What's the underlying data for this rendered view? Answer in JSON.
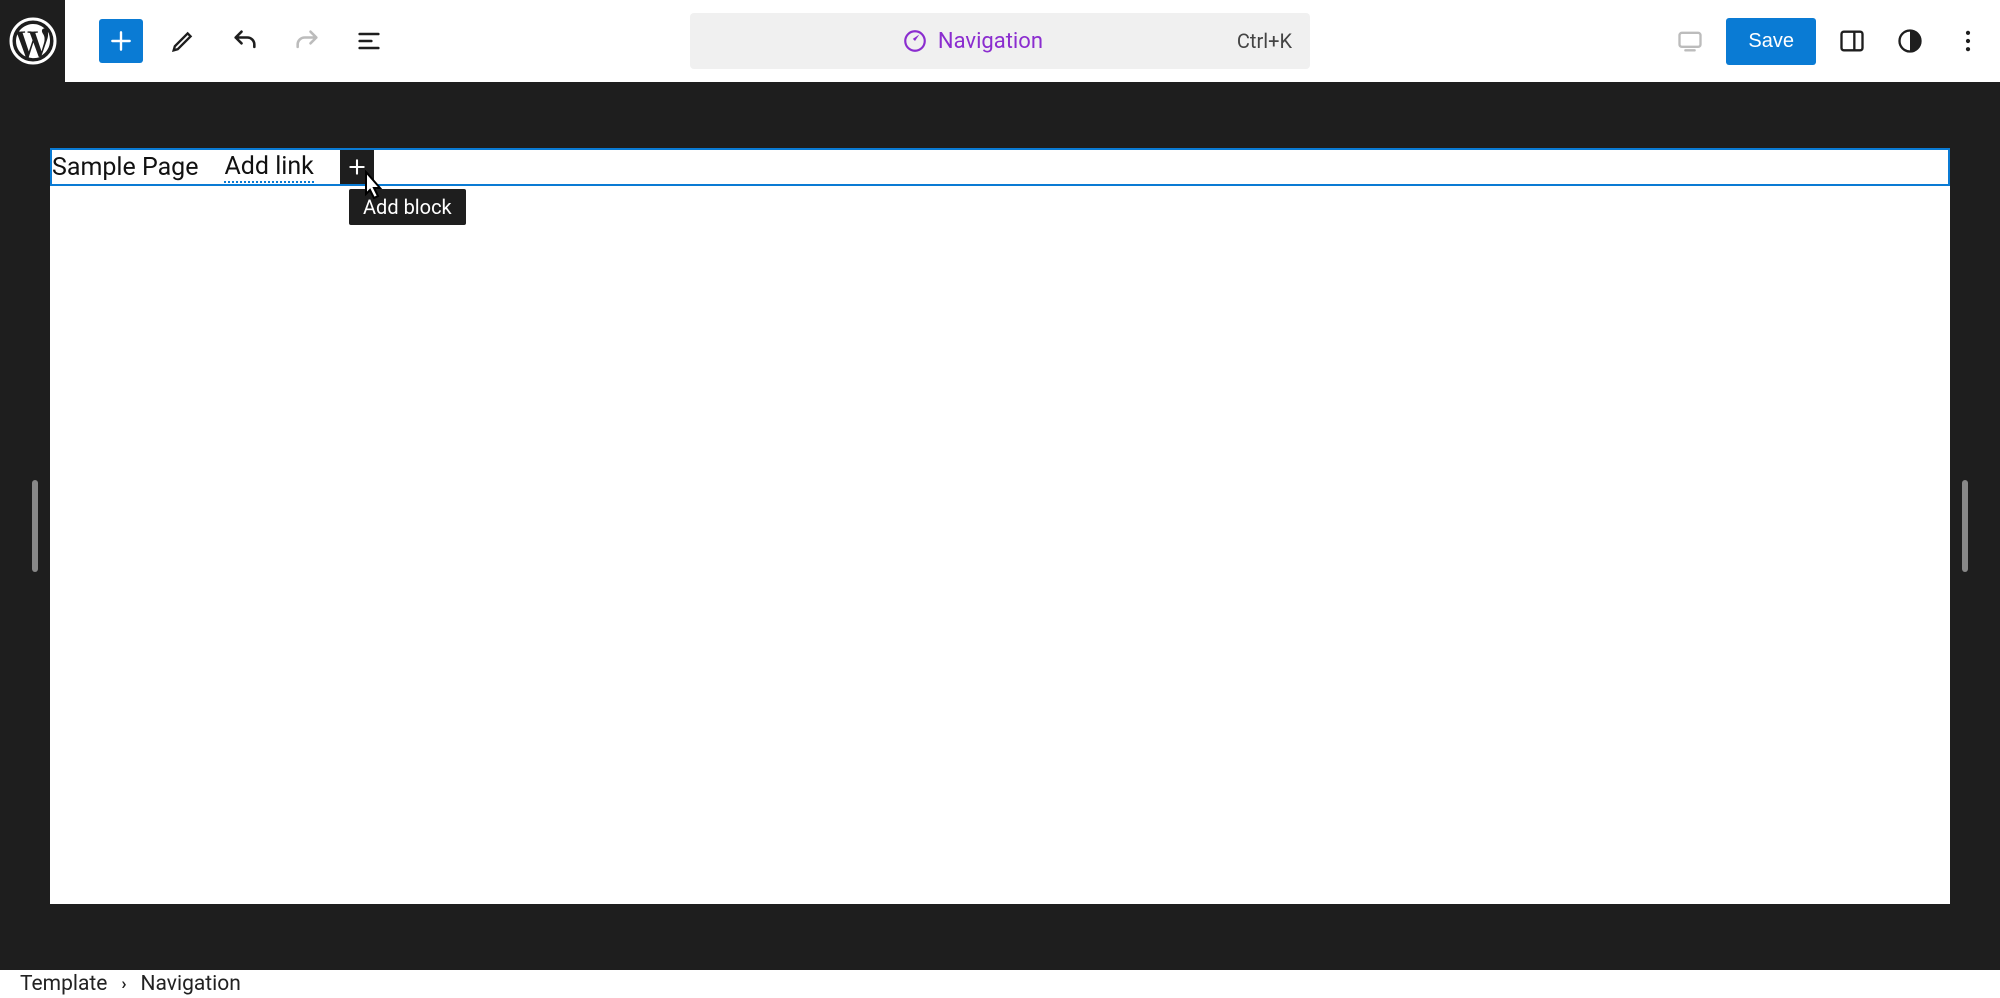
{
  "toolbar": {
    "center_title": "Navigation",
    "shortcut": "Ctrl+K",
    "save_label": "Save"
  },
  "canvas": {
    "nav_items": [
      "Sample Page"
    ],
    "add_link_label": "Add link",
    "tooltip": "Add block"
  },
  "breadcrumb": {
    "root": "Template",
    "current": "Navigation"
  }
}
